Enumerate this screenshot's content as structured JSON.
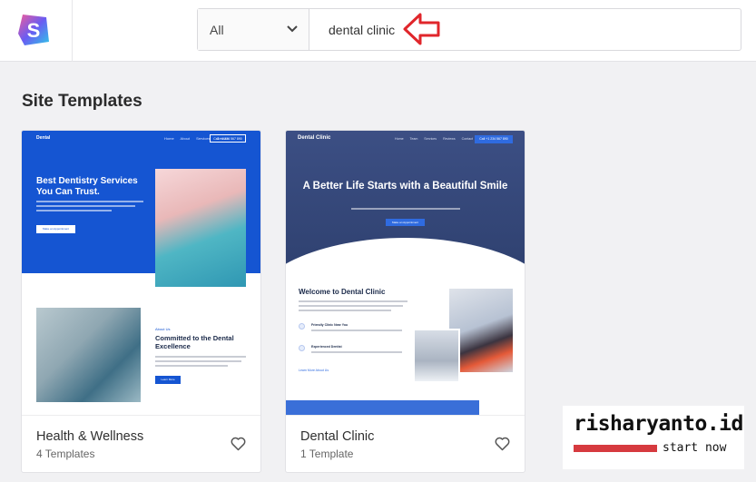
{
  "header": {
    "logo_letter": "S",
    "filter_select": {
      "value": "All",
      "icon": "chevron-down-icon"
    },
    "search": {
      "value": "dental clinic",
      "placeholder": ""
    },
    "annotation_icon": "red-arrow-left-icon"
  },
  "section": {
    "title": "Site Templates"
  },
  "cards": [
    {
      "title": "Health & Wellness",
      "count": "4 Templates",
      "preview": {
        "brand": "Dental",
        "nav_links": "Home About Services Contact",
        "nav_button": "Call +1 234 567 890",
        "headline": "Best Dentistry Services You Can Trust.",
        "cta": "Make an Appointment",
        "eyebrow": "About Us",
        "section_heading": "Committed to the Dental Excellence",
        "section_button": "Learn More"
      }
    },
    {
      "title": "Dental Clinic",
      "count": "1 Template",
      "preview": {
        "brand": "Dental Clinic",
        "nav_links": "Home Team Services Reviews Contact",
        "nav_button": "Call +1 234 567 890",
        "headline": "A Better Life Starts with a Beautiful Smile",
        "cta": "Make an Appointment",
        "welcome_heading": "Welcome to Dental Clinic",
        "feature_1": "Friendly Clinic Near You",
        "feature_2": "Experienced Dentist",
        "link": "Learn More About Us"
      }
    }
  ],
  "watermark": {
    "title": "risharyanto.id",
    "subtitle": "start now"
  },
  "colors": {
    "accent": "#1555d2",
    "annotation_red": "#e0262b"
  }
}
